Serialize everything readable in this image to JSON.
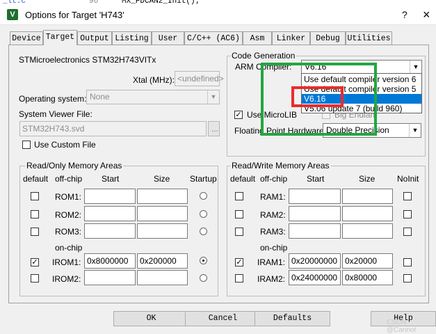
{
  "background_editor": {
    "line_number": "96",
    "code_text": "MX_FDCAN2_Init();"
  },
  "window": {
    "title": "Options for Target 'H743'",
    "help_glyph": "?",
    "close_glyph": "×"
  },
  "tabs": [
    {
      "label": "Device"
    },
    {
      "label": "Target"
    },
    {
      "label": "Output"
    },
    {
      "label": "Listing"
    },
    {
      "label": "User"
    },
    {
      "label": "C/C++ (AC6)"
    },
    {
      "label": "Asm"
    },
    {
      "label": "Linker"
    },
    {
      "label": "Debug"
    },
    {
      "label": "Utilities"
    }
  ],
  "device": {
    "name": "STMicroelectronics STM32H743VITx",
    "xtal_label": "Xtal (MHz):",
    "xtal_value": "<undefined>",
    "os_label": "Operating system:",
    "os_value": "None",
    "svd_label": "System Viewer File:",
    "svd_value": "STM32H743.svd",
    "svd_browse": "...",
    "custom_file_label": "Use Custom File"
  },
  "code_generation": {
    "title": "Code Generation",
    "compiler_label": "ARM Compiler:",
    "compiler_value": "V6.16",
    "dropdown_options": [
      "Use default compiler version 6",
      "Use default compiler version 5",
      "V6.16",
      "V5.06 update 7 (build 960)"
    ],
    "microlib_label": "Use MicroLIB",
    "big_endian_label": "Big Endian",
    "fph_label": "Floating Point Hardware:",
    "fph_value": "Double Precision"
  },
  "readonly_memory": {
    "title": "Read/Only Memory Areas",
    "headers": [
      "default",
      "off-chip",
      "Start",
      "Size",
      "Startup"
    ],
    "offchip": [
      {
        "label": "ROM1:",
        "start": "",
        "size": ""
      },
      {
        "label": "ROM2:",
        "start": "",
        "size": ""
      },
      {
        "label": "ROM3:",
        "start": "",
        "size": ""
      }
    ],
    "onchip_label": "on-chip",
    "onchip": [
      {
        "label": "IROM1:",
        "start": "0x8000000",
        "size": "0x200000"
      },
      {
        "label": "IROM2:",
        "start": "",
        "size": ""
      }
    ]
  },
  "readwrite_memory": {
    "title": "Read/Write Memory Areas",
    "headers": [
      "default",
      "off-chip",
      "Start",
      "Size",
      "NoInit"
    ],
    "offchip": [
      {
        "label": "RAM1:",
        "start": "",
        "size": ""
      },
      {
        "label": "RAM2:",
        "start": "",
        "size": ""
      },
      {
        "label": "RAM3:",
        "start": "",
        "size": ""
      }
    ],
    "onchip_label": "on-chip",
    "onchip": [
      {
        "label": "IRAM1:",
        "start": "0x20000000",
        "size": "0x20000"
      },
      {
        "label": "IRAM2:",
        "start": "0x24000000",
        "size": "0x80000"
      }
    ]
  },
  "buttons": {
    "ok": "OK",
    "cancel": "Cancel",
    "defaults": "Defaults",
    "help": "Help"
  },
  "watermark": "CSDN @Cannot",
  "colors": {
    "highlight_green": "#21a73f",
    "highlight_red": "#e92c2c",
    "selection_blue": "#0078d7"
  }
}
